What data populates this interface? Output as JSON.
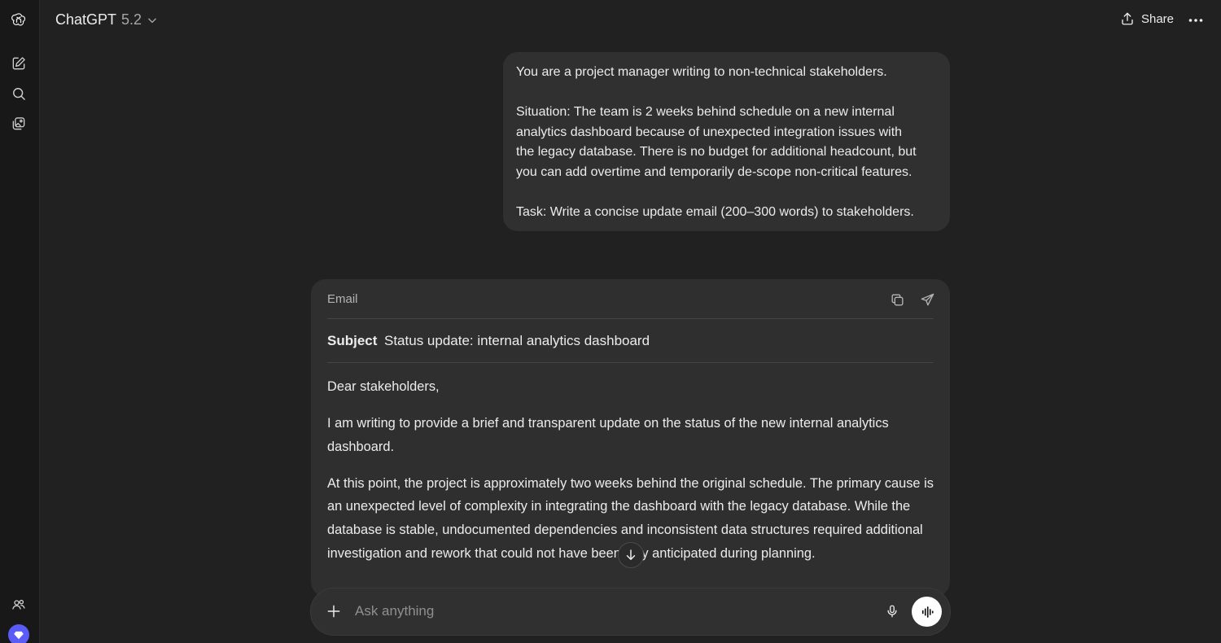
{
  "header": {
    "model_name": "ChatGPT",
    "model_version": "5.2",
    "share_label": "Share"
  },
  "user_message": {
    "lines": [
      "You are a project manager writing to non-technical stakeholders.",
      "",
      "Situation: The team is 2 weeks behind schedule on a new internal",
      "analytics dashboard because of unexpected integration issues with",
      "the legacy database. There is no budget for additional headcount, but",
      "you can add overtime and temporarily de-scope non-critical features.",
      "",
      "Task: Write a concise update email (200–300 words) to stakeholders."
    ]
  },
  "email_card": {
    "label": "Email",
    "subject_key": "Subject",
    "subject_value": "Status update: internal analytics dashboard",
    "paragraphs": [
      "Dear stakeholders,",
      "I am writing to provide a brief and transparent update on the status of the new internal analytics dashboard.",
      "At this point, the project is approximately two weeks behind the original schedule. The primary cause is an unexpected level of complexity in integrating the dashboard with the legacy database. While the database is stable, undocumented dependencies and inconsistent data structures required additional investigation and rework that could not have been fully anticipated during planning."
    ]
  },
  "composer": {
    "placeholder": "Ask anything"
  },
  "icons": {
    "logo": "openai-logo-icon",
    "new_chat": "pencil-square-icon",
    "search": "search-icon",
    "library": "images-icon",
    "group": "people-icon",
    "upgrade": "diamond-icon",
    "share": "upload-icon",
    "more": "ellipsis-icon",
    "copy": "copy-icon",
    "send": "paper-plane-icon",
    "scroll": "arrow-down-icon",
    "add": "plus-icon",
    "mic": "microphone-icon",
    "voice": "waveform-icon"
  },
  "colors": {
    "background": "#212121",
    "rail": "#181818",
    "bubble": "#303030",
    "card": "#2f2f2f",
    "upgrade_accent": "#5b5bf7"
  }
}
